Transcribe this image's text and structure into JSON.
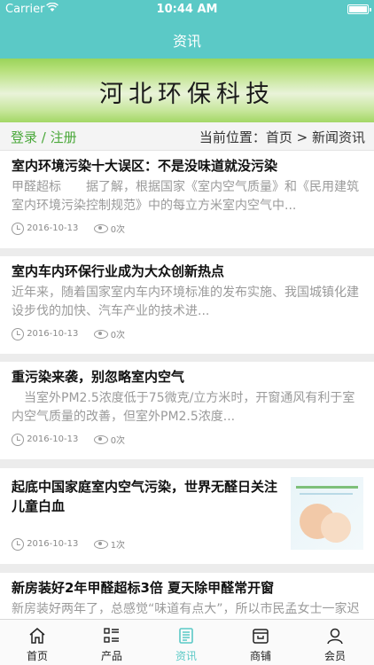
{
  "status_bar": {
    "carrier": "Carrier",
    "time": "10:44 AM"
  },
  "nav": {
    "title": "资讯"
  },
  "banner": {
    "text": "河北环保科技"
  },
  "login_bar": {
    "login": "登录 / 注册",
    "breadcrumb": "当前位置：首页 > 新闻资讯"
  },
  "articles": [
    {
      "title": "室内环境污染十大误区：不是没味道就没污染",
      "desc": "甲醛超标　　据了解，根据国家《室内空气质量》和《民用建筑室内环境污染控制规范》中的每立方米室内空气中...",
      "date": "2016-10-13",
      "views": "0次"
    },
    {
      "title": "室内车内环保行业成为大众创新热点",
      "desc": "近年来，随着国家室内车内环境标准的发布实施、我国城镇化建设步伐的加快、汽车产业的技术进...",
      "date": "2016-10-13",
      "views": "0次"
    },
    {
      "title": "重污染来袭，别忽略室内空气",
      "desc": "　当室外PM2.5浓度低于75微克/立方米时，开窗通风有利于室内空气质量的改善，但室外PM2.5浓度...",
      "date": "2016-10-13",
      "views": "0次"
    },
    {
      "title": "起底中国家庭室内空气污染，世界无醛日关注儿童白血",
      "desc": "",
      "date": "2016-10-13",
      "views": "1次",
      "thumb_icon": "baby-thumbnail"
    },
    {
      "title": "新房装好2年甲醛超标3倍 夏天除甲醛常开窗",
      "desc": "新房装好两年了，总感觉“味道有点大”，所以市民孟女士一家迟"
    }
  ],
  "tabs": [
    {
      "label": "首页",
      "icon": "home-icon"
    },
    {
      "label": "产品",
      "icon": "list-icon"
    },
    {
      "label": "资讯",
      "icon": "news-icon",
      "active": true
    },
    {
      "label": "商铺",
      "icon": "shop-icon"
    },
    {
      "label": "会员",
      "icon": "user-icon"
    }
  ],
  "colors": {
    "accent": "#5bc9c6",
    "login_green": "#4aa83a"
  }
}
